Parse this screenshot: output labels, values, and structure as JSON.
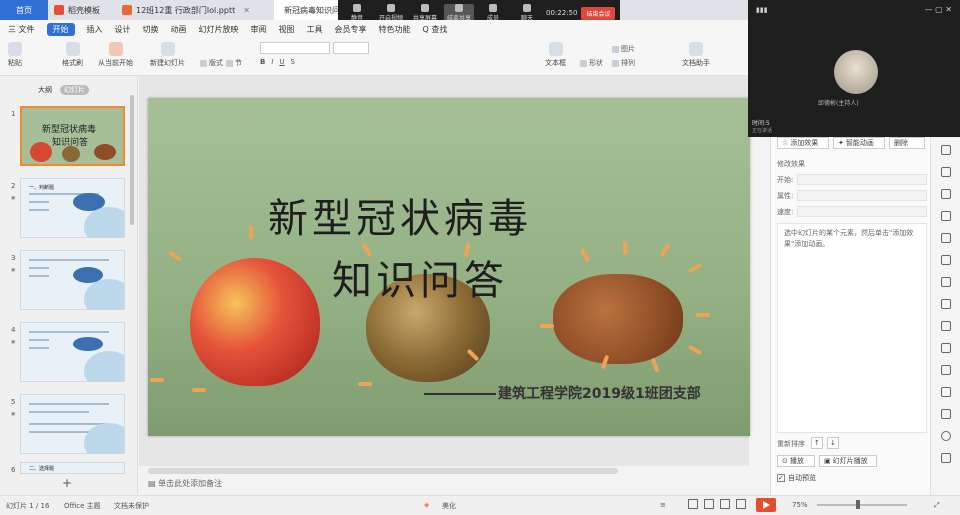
{
  "tabs": [
    {
      "label": "首页",
      "color": "#2f6fd6"
    },
    {
      "label": "稻壳模板",
      "color": "#e94e3c"
    },
    {
      "label": "12班12重 行政部门lol.pptt",
      "color": "#e96a2e"
    },
    {
      "label": "新冠病毒知识问答",
      "color": "#e96a2e"
    }
  ],
  "meeting": {
    "buttons": [
      "静音",
      "开启视频",
      "共享屏幕",
      "结束共享",
      "成员",
      "聊天"
    ],
    "timer": "00:22:50",
    "end_label": "结束会议"
  },
  "menu": [
    "三 文件",
    "开始",
    "插入",
    "设计",
    "切换",
    "动画",
    "幻灯片放映",
    "审阅",
    "视图",
    "工具",
    "会员专享",
    "特色功能",
    "Q 查找"
  ],
  "ribbon": {
    "paste": "粘贴",
    "format_painter": "格式刷",
    "from_current": "从当前开始",
    "new_slide": "新建幻灯片",
    "layout": "版式",
    "section": "节",
    "text_box": "文本框",
    "shapes": "形状",
    "arrange": "排列",
    "image": "图片",
    "typeset": "文档助手"
  },
  "left_panel": {
    "tab_outline": "大纲",
    "tab_slides": "幻灯片",
    "slide_numbers": [
      "1",
      "2",
      "3",
      "4",
      "5",
      "6"
    ]
  },
  "slide": {
    "title_line1": "新型冠状病毒",
    "title_line2": "知识问答",
    "subtitle": "建筑工程学院2019级1班团支部"
  },
  "thumb1": {
    "line1": "新型冠状病毒",
    "line2": "知识问答"
  },
  "thumb2": {
    "title": "一、判断题"
  },
  "thumb6": {
    "title": "二、选择题"
  },
  "video": {
    "participant_label": "邱德彬(主持人)",
    "name_tag": "时间:5",
    "sub": "正在讲话"
  },
  "right_panel": {
    "add_effect": "添加效果",
    "smart_anim": "智能动画",
    "delete": "删除",
    "modify": "修改效果",
    "start": "开始:",
    "property": "属性:",
    "speed": "速度:",
    "hint": "选中幻灯片的某个元素，然后单击\"添加效果\"添加动画。",
    "reorder": "重新排序",
    "play": "播放",
    "slideshow": "幻灯片播放",
    "autopreview": "自动预览"
  },
  "note": "单击此处添加备注",
  "status": {
    "slide_count": "幻灯片 1 / 16",
    "theme": "Office 主题",
    "font_missing": "文档未保护",
    "beautify": "美化",
    "zoom": "75%"
  }
}
